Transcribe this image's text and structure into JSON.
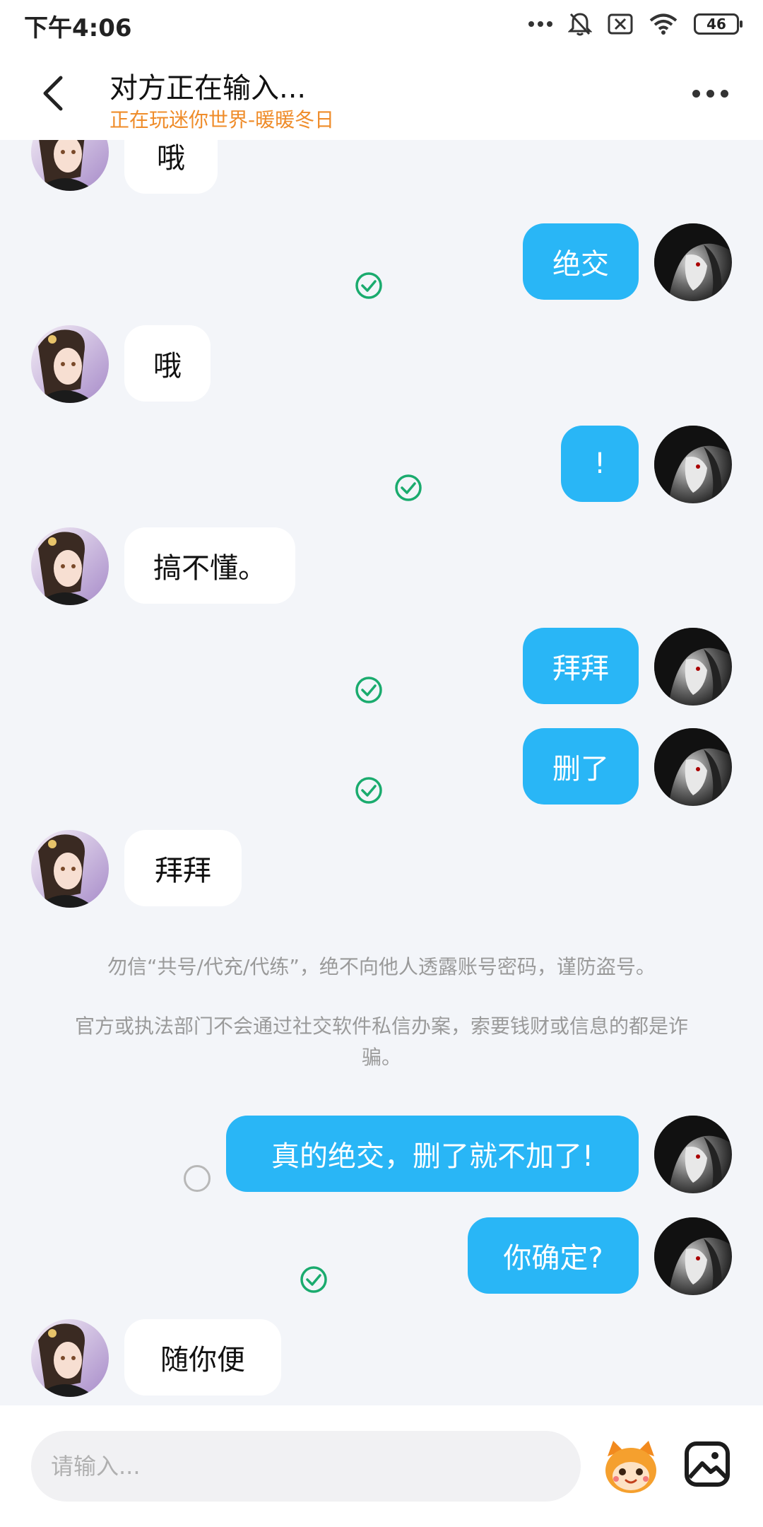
{
  "status_bar": {
    "time": "下午4:06",
    "battery": "46"
  },
  "header": {
    "title": "对方正在输入...",
    "subtitle": "正在玩迷你世界-暖暖冬日"
  },
  "messages": [
    {
      "side": "left",
      "text": "哦"
    },
    {
      "side": "right",
      "text": "绝交",
      "status": "read"
    },
    {
      "side": "left",
      "text": "哦"
    },
    {
      "side": "right",
      "text": "!",
      "status": "read"
    },
    {
      "side": "left",
      "text": "搞不懂。"
    },
    {
      "side": "right",
      "text": "拜拜",
      "status": "read"
    },
    {
      "side": "right",
      "text": "删了",
      "status": "read"
    },
    {
      "side": "left",
      "text": "拜拜"
    },
    {
      "side": "right",
      "text": "真的绝交，删了就不加了!",
      "status": "sending"
    },
    {
      "side": "right",
      "text": "你确定?",
      "status": "read"
    },
    {
      "side": "left",
      "text": "随你便"
    }
  ],
  "notice": {
    "line1": "勿信“共号/代充/代练”，绝不向他人透露账号密码，谨防盗号。",
    "line2": "官方或执法部门不会通过社交软件私信办案，索要钱财或信息的都是诈骗。"
  },
  "input_bar": {
    "placeholder": "请输入..."
  },
  "colors": {
    "accent": "#29b6f6",
    "subtitle": "#ef8c2a",
    "check": "#1aab6e",
    "background": "#f3f5f9"
  },
  "icons": [
    "back-arrow-icon",
    "more-icon",
    "read-check-icon",
    "sending-circle-icon",
    "mascot-emoji-icon",
    "image-icon",
    "wifi-icon",
    "mute-icon",
    "battery-icon"
  ]
}
